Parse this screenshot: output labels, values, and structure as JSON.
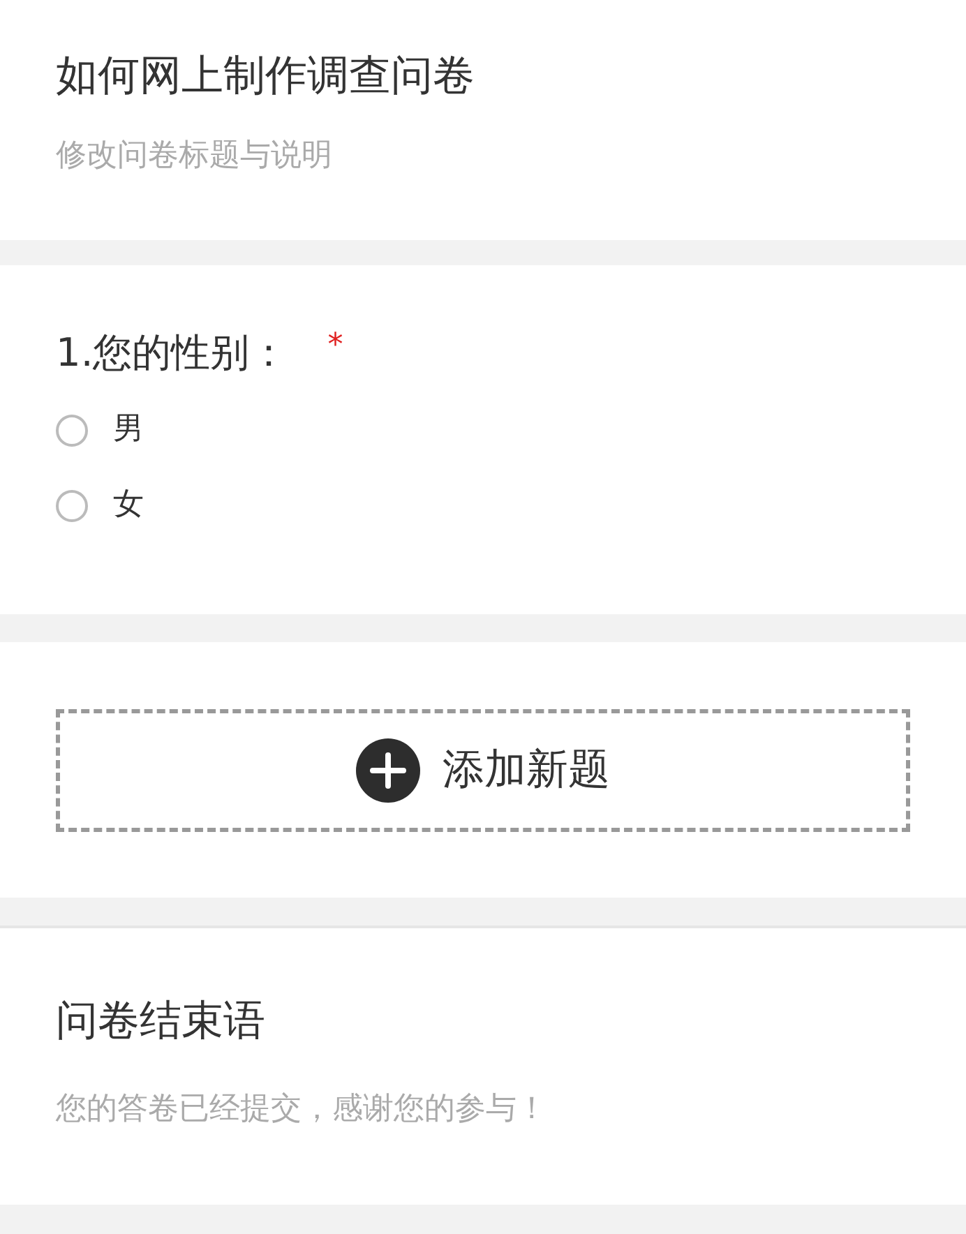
{
  "header": {
    "title": "如何网上制作调查问卷",
    "description": "修改问卷标题与说明"
  },
  "question": {
    "label": "1.您的性别：",
    "required": true,
    "required_mark": "*",
    "options": [
      {
        "label": "男",
        "selected": false
      },
      {
        "label": "女",
        "selected": false
      }
    ]
  },
  "add_button": {
    "label": "添加新题"
  },
  "ending": {
    "title": "问卷结束语",
    "message": "您的答卷已经提交，感谢您的参与！"
  }
}
